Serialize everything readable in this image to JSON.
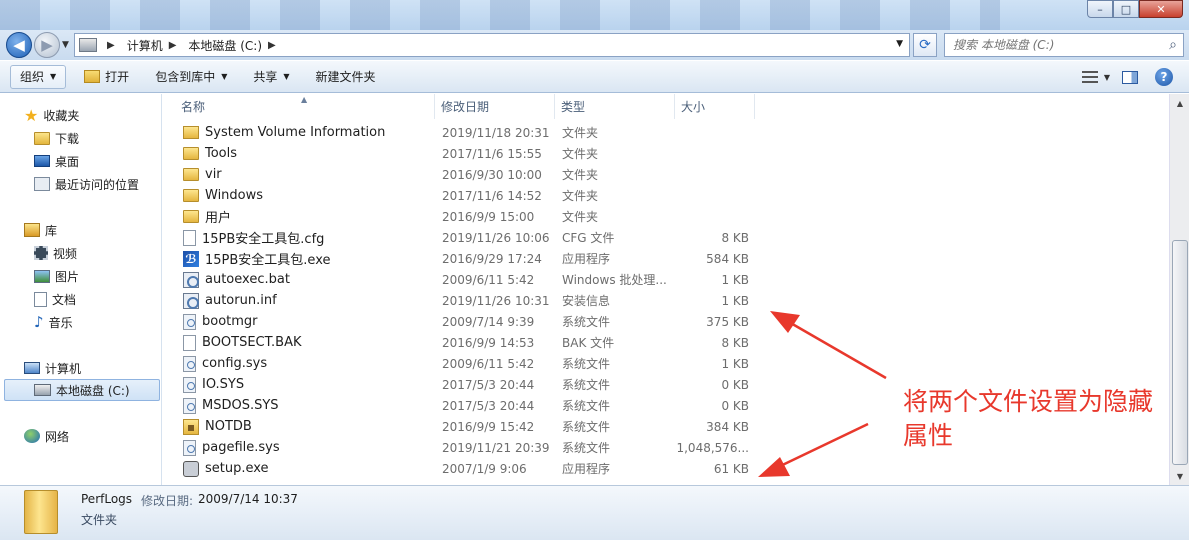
{
  "window": {
    "controls": {
      "minimize": "–",
      "maximize": "□",
      "close": "✕"
    }
  },
  "address": {
    "crumbs": [
      "计算机",
      "本地磁盘 (C:)"
    ],
    "search_placeholder": "搜索 本地磁盘 (C:)"
  },
  "toolbar": {
    "organize": "组织",
    "open": "打开",
    "include_library": "包含到库中",
    "share": "共享",
    "new_folder": "新建文件夹"
  },
  "nav": {
    "favorites": "收藏夹",
    "downloads": "下载",
    "desktop": "桌面",
    "recent": "最近访问的位置",
    "libraries": "库",
    "videos": "视频",
    "pictures": "图片",
    "documents": "文档",
    "music": "音乐",
    "computer": "计算机",
    "local_disk": "本地磁盘 (C:)",
    "network": "网络"
  },
  "columns": {
    "name": "名称",
    "date": "修改日期",
    "type": "类型",
    "size": "大小"
  },
  "files": [
    {
      "name": "System Volume Information",
      "date": "2019/11/18 20:31",
      "type": "文件夹",
      "size": "",
      "icon": "lock-folder-icon"
    },
    {
      "name": "Tools",
      "date": "2017/11/6 15:55",
      "type": "文件夹",
      "size": "",
      "icon": "folder-icon"
    },
    {
      "name": "vir",
      "date": "2016/9/30 10:00",
      "type": "文件夹",
      "size": "",
      "icon": "folder-icon"
    },
    {
      "name": "Windows",
      "date": "2017/11/6 14:52",
      "type": "文件夹",
      "size": "",
      "icon": "folder-icon"
    },
    {
      "name": "用户",
      "date": "2016/9/9 15:00",
      "type": "文件夹",
      "size": "",
      "icon": "folder-icon"
    },
    {
      "name": "15PB安全工具包.cfg",
      "date": "2019/11/26 10:06",
      "type": "CFG 文件",
      "size": "8 KB",
      "icon": "page-icon"
    },
    {
      "name": "15PB安全工具包.exe",
      "date": "2016/9/29 17:24",
      "type": "应用程序",
      "size": "584 KB",
      "icon": "exe-icon"
    },
    {
      "name": "autoexec.bat",
      "date": "2009/6/11 5:42",
      "type": "Windows 批处理...",
      "size": "1 KB",
      "icon": "batch-icon"
    },
    {
      "name": "autorun.inf",
      "date": "2019/11/26 10:31",
      "type": "安装信息",
      "size": "1 KB",
      "icon": "batch-icon"
    },
    {
      "name": "bootmgr",
      "date": "2009/7/14 9:39",
      "type": "系统文件",
      "size": "375 KB",
      "icon": "system-file-icon"
    },
    {
      "name": "BOOTSECT.BAK",
      "date": "2016/9/9 14:53",
      "type": "BAK 文件",
      "size": "8 KB",
      "icon": "page-icon"
    },
    {
      "name": "config.sys",
      "date": "2009/6/11 5:42",
      "type": "系统文件",
      "size": "1 KB",
      "icon": "system-file-icon"
    },
    {
      "name": "IO.SYS",
      "date": "2017/5/3 20:44",
      "type": "系统文件",
      "size": "0 KB",
      "icon": "system-file-icon"
    },
    {
      "name": "MSDOS.SYS",
      "date": "2017/5/3 20:44",
      "type": "系统文件",
      "size": "0 KB",
      "icon": "system-file-icon"
    },
    {
      "name": "NOTDB",
      "date": "2016/9/9 15:42",
      "type": "系统文件",
      "size": "384 KB",
      "icon": "lock-file-icon"
    },
    {
      "name": "pagefile.sys",
      "date": "2019/11/21 20:39",
      "type": "系统文件",
      "size": "1,048,576...",
      "icon": "system-file-icon"
    },
    {
      "name": "setup.exe",
      "date": "2007/1/9 9:06",
      "type": "应用程序",
      "size": "61 KB",
      "icon": "setup-icon"
    }
  ],
  "details": {
    "name": "PerfLogs",
    "date_label": "修改日期:",
    "date_value": "2009/7/14 10:37",
    "type": "文件夹"
  },
  "annotation": {
    "text": "将两个文件设置为隐藏属性",
    "color": "#e8382c"
  }
}
